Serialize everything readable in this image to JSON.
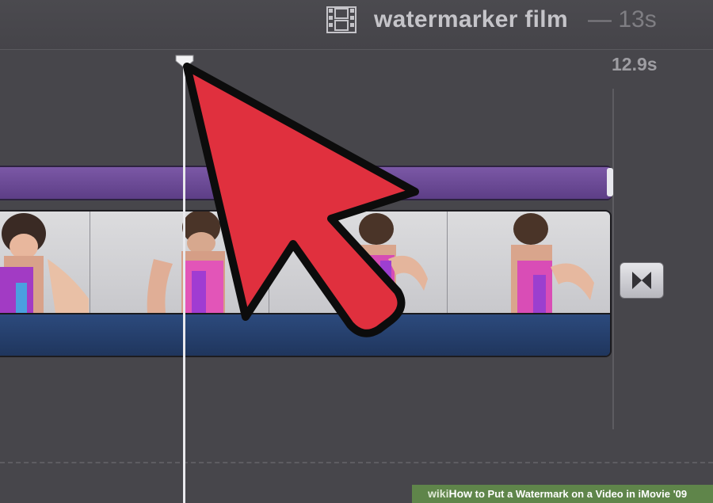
{
  "header": {
    "project_title": "watermarker film",
    "project_duration": "— 13s",
    "film_icon": "filmstrip-icon"
  },
  "timeline": {
    "time_readout": "12.9s",
    "playhead_icon": "playhead-icon",
    "transition_icon": "transition-bowtie-icon",
    "title_bar_color": "#6a4a96",
    "audio_strip_color": "#27406c"
  },
  "overlay": {
    "pointer_icon": "arrow-pointer-icon",
    "pointer_color": "#e0303e"
  },
  "banner": {
    "site_prefix": "wiki",
    "how": "How",
    "text": " to Put a Watermark on a Video in iMovie '09"
  }
}
